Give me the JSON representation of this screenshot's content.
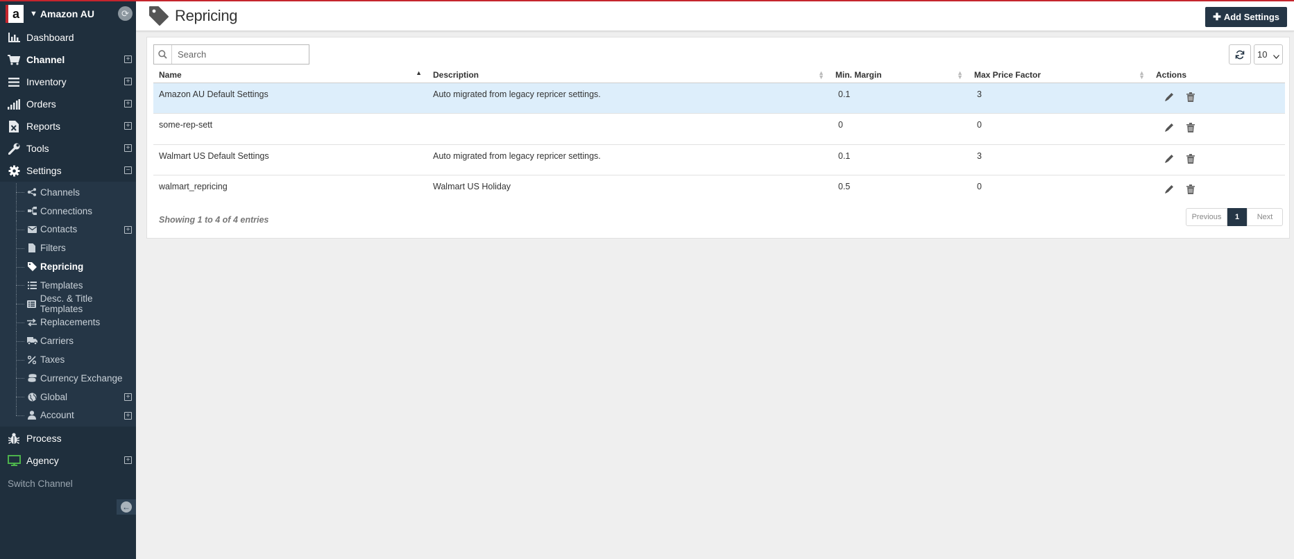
{
  "sidebar": {
    "account_name": "Amazon AU",
    "logo_letter": "a",
    "nav": [
      {
        "label": "Dashboard",
        "icon": "bar-chart-icon",
        "expandable": false
      },
      {
        "label": "Channel",
        "icon": "cart-icon",
        "expandable": true
      },
      {
        "label": "Inventory",
        "icon": "list-icon",
        "expandable": true
      },
      {
        "label": "Orders",
        "icon": "signal-bars-icon",
        "expandable": true
      },
      {
        "label": "Reports",
        "icon": "excel-file-icon",
        "expandable": true
      },
      {
        "label": "Tools",
        "icon": "wrench-icon",
        "expandable": true
      },
      {
        "label": "Settings",
        "icon": "gear-icon",
        "expandable": true,
        "expanded": true
      }
    ],
    "settings_sub": [
      {
        "label": "Channels",
        "icon": "share-icon"
      },
      {
        "label": "Connections",
        "icon": "sitemap-icon"
      },
      {
        "label": "Contacts",
        "icon": "envelope-icon",
        "expandable": true
      },
      {
        "label": "Filters",
        "icon": "file-icon"
      },
      {
        "label": "Repricing",
        "icon": "tag-icon",
        "active": true
      },
      {
        "label": "Templates",
        "icon": "list-icon"
      },
      {
        "label": "Desc. & Title Templates",
        "icon": "list-alt-icon"
      },
      {
        "label": "Replacements",
        "icon": "exchange-icon"
      },
      {
        "label": "Carriers",
        "icon": "truck-icon"
      },
      {
        "label": "Taxes",
        "icon": "percent-icon"
      },
      {
        "label": "Currency Exchange",
        "icon": "coins-icon"
      },
      {
        "label": "Global",
        "icon": "globe-icon",
        "expandable": true
      },
      {
        "label": "Account",
        "icon": "user-icon",
        "expandable": true
      }
    ],
    "nav_bottom": [
      {
        "label": "Process",
        "icon": "bug-icon",
        "expandable": false
      },
      {
        "label": "Agency",
        "icon": "monitor-icon",
        "expandable": true,
        "icon_color": "#4cb24c"
      }
    ],
    "switch_channel": "Switch Channel"
  },
  "header": {
    "title": "Repricing",
    "add_button": "Add Settings"
  },
  "table": {
    "search_placeholder": "Search",
    "page_size": "10",
    "columns": [
      "Name",
      "Description",
      "Min. Margin",
      "Max Price Factor",
      "Actions"
    ],
    "rows": [
      {
        "name": "Amazon AU Default Settings",
        "description": "Auto migrated from legacy repricer settings.",
        "min_margin": "0.1",
        "max_price_factor": "3",
        "selected": true
      },
      {
        "name": "some-rep-sett",
        "description": "",
        "min_margin": "0",
        "max_price_factor": "0",
        "selected": false
      },
      {
        "name": "Walmart US Default Settings",
        "description": "Auto migrated from legacy repricer settings.",
        "min_margin": "0.1",
        "max_price_factor": "3",
        "selected": false
      },
      {
        "name": "walmart_repricing",
        "description": "Walmart US Holiday",
        "min_margin": "0.5",
        "max_price_factor": "0",
        "selected": false
      }
    ],
    "info": "Showing 1 to 4 of 4 entries",
    "pagination": {
      "previous": "Previous",
      "current": "1",
      "next": "Next"
    }
  },
  "colors": {
    "sidebar_bg": "#1f2f3d",
    "accent_dark": "#253646",
    "selected_row": "#ddeefb",
    "brand_red": "#c5252d"
  }
}
